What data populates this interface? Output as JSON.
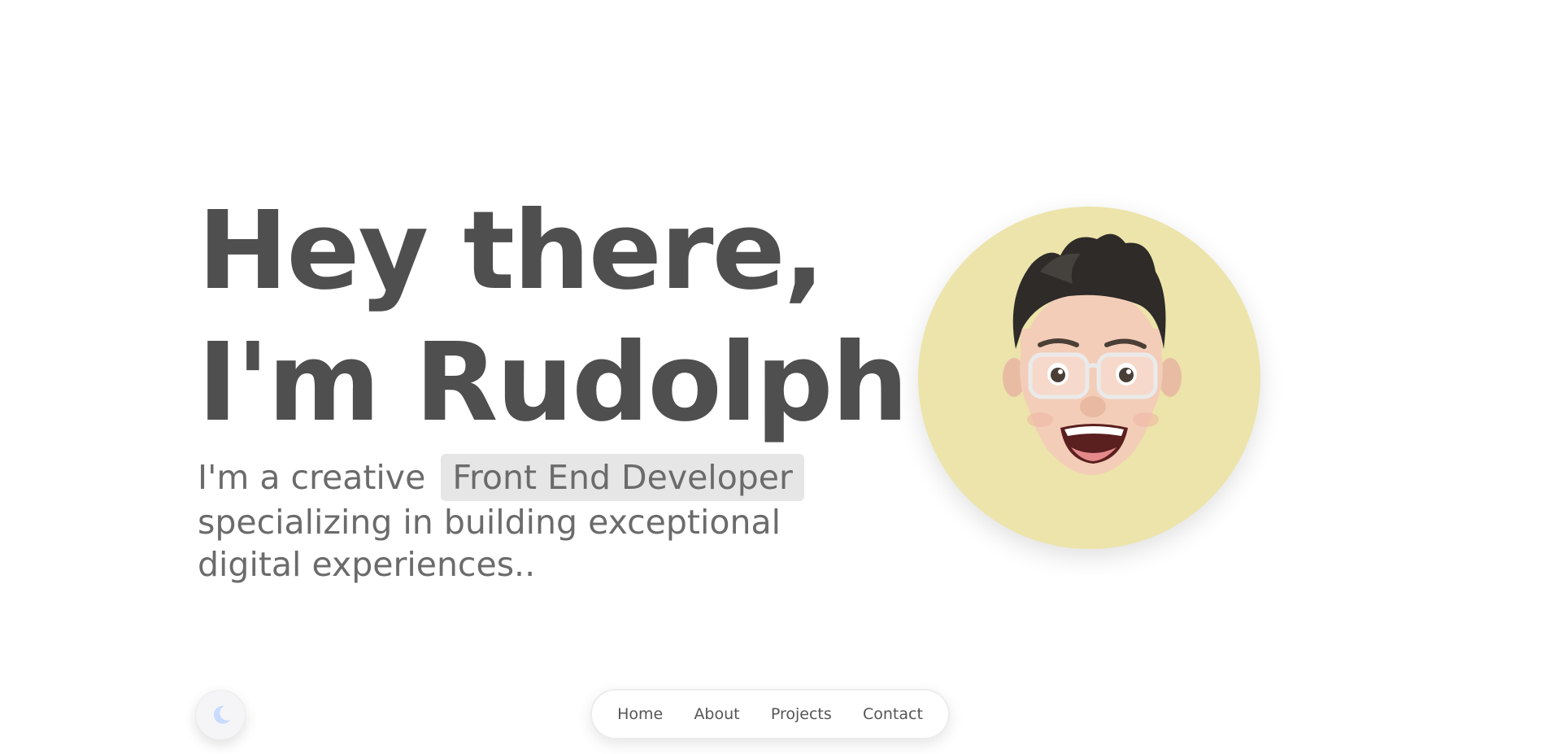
{
  "hero": {
    "headline_line1": "Hey there,",
    "headline_line2": "I'm Rudolph",
    "tagline_prefix": "I'm a creative",
    "role": "Front End Developer",
    "tagline_suffix": "specializing in building exceptional digital experiences.."
  },
  "avatar": {
    "icon": "memoji-avatar",
    "background_color": "#ece4aa"
  },
  "theme_toggle": {
    "icon": "moon-icon"
  },
  "nav": {
    "items": [
      {
        "label": "Home"
      },
      {
        "label": "About"
      },
      {
        "label": "Projects"
      },
      {
        "label": "Contact"
      }
    ]
  }
}
